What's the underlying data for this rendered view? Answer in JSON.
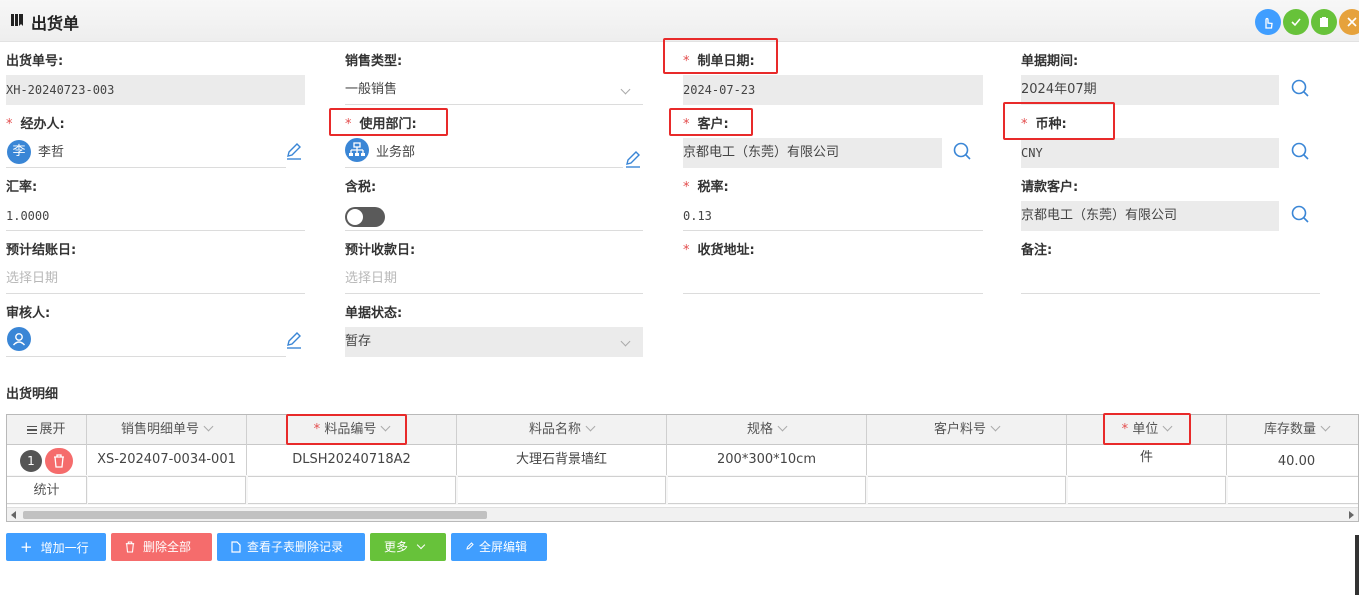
{
  "window": {
    "title": "出货单"
  },
  "labels": {
    "shipment_no": "出货单号:",
    "sales_type": "销售类型:",
    "doc_date": "制单日期:",
    "doc_period": "单据期间:",
    "handler": "经办人:",
    "dept": "使用部门:",
    "customer": "客户:",
    "currency": "币种:",
    "exchange_rate": "汇率:",
    "tax_included": "含税:",
    "tax_rate": "税率:",
    "billing_customer": "请款客户:",
    "settle_date": "预计结账日:",
    "receive_date": "预计收款日:",
    "ship_address": "收货地址:",
    "remark": "备注:",
    "reviewer": "审核人:",
    "status": "单据状态:"
  },
  "required_mark": "*",
  "values": {
    "shipment_no": "XH-20240723-003",
    "sales_type": "一般销售",
    "doc_date": "2024-07-23",
    "doc_period": "2024年07期",
    "handler_avatar": "李",
    "handler": "李哲",
    "dept": "业务部",
    "customer": "京都电工（东莞）有限公司",
    "currency": "CNY",
    "exchange_rate": "1.0000",
    "tax_included": false,
    "tax_rate": "0.13",
    "billing_customer": "京都电工（东莞）有限公司",
    "settle_date_placeholder": "选择日期",
    "receive_date_placeholder": "选择日期",
    "status": "暂存"
  },
  "detail": {
    "title": "出货明细",
    "columns": [
      "展开",
      "销售明细单号",
      "料品编号",
      "料品名称",
      "规格",
      "客户料号",
      "单位",
      "库存数量"
    ],
    "rows": [
      {
        "index": "1",
        "order_no": "XS-202407-0034-001",
        "item_code": "DLSH20240718A2",
        "item_name": "大理石背景墙红",
        "spec": "200*300*10cm",
        "cust_code": "",
        "unit": "件",
        "stock": "40.00"
      }
    ],
    "summary_label": "统计"
  },
  "buttons": {
    "add_row": "增加一行",
    "delete_all": "删除全部",
    "view_deleted": "查看子表删除记录",
    "more": "更多",
    "fullscreen_edit": "全屏编辑"
  },
  "colors": {
    "primary": "#409eff",
    "danger": "#f56c6c",
    "success": "#67c23a",
    "warning": "#e6a23c",
    "highlight": "#e82a2a"
  }
}
